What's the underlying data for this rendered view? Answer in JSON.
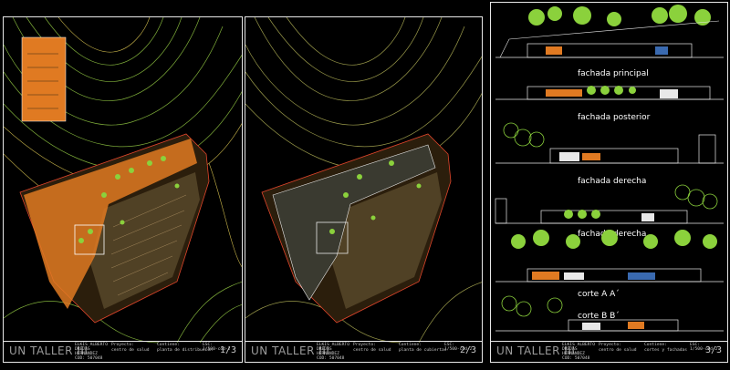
{
  "sheets": [
    {
      "brand": "UN TALLER III",
      "student": "ELKIS ALBERTO\nDREJAS\nHERNANDEZ\nCOD: 507048",
      "project_label": "Proyecto:",
      "project": "centro de salud",
      "content_label": "Contiene:",
      "content": "planta de distribución",
      "scale": "ESC:\n1/500-cod-2",
      "page": "1/3"
    },
    {
      "brand": "UN TALLER III",
      "student": "ELKIS ALBERTO\nDREJAS\nHERNANDEZ\nCOD: 507048",
      "project_label": "Proyecto:",
      "project": "centro de salud",
      "content_label": "Contiene:",
      "content": "planta de cubiertas",
      "scale": "ESC:\n1/500-cod-2",
      "page": "2/3"
    },
    {
      "brand": "UN TALLER III",
      "student": "ELKIS ALBERTO\nDREJAS\nHERNANDEZ\nCOD: 507048",
      "project_label": "Proyecto:",
      "project": "centro de salud",
      "content_label": "Contiene:",
      "content": "cortes y fachadas",
      "scale": "ESC:\n1/500-cod-2",
      "page": "3/3"
    }
  ],
  "elevations": [
    {
      "label": "fachada principal"
    },
    {
      "label": "fachada posterior"
    },
    {
      "label": "fachada derecha"
    },
    {
      "label": "fachada derecha"
    },
    {
      "label": "corte A A´"
    },
    {
      "label": "corte B B´"
    }
  ],
  "colors": {
    "contour_green": "#7fae3a",
    "contour_yellow": "#c9b54a",
    "plan_orange": "#e07a22",
    "hatch_tan": "#b9996a",
    "tree_green": "#8bd13c",
    "boundary_red": "#e0452b"
  }
}
